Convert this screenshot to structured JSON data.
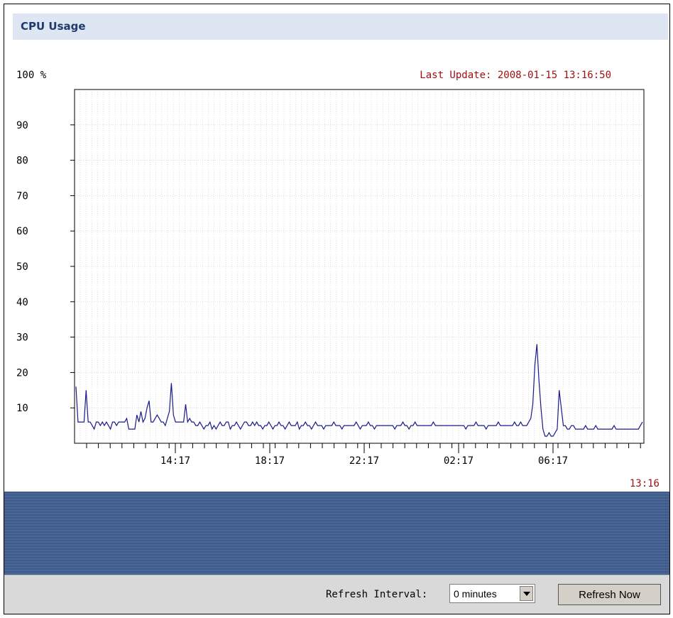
{
  "title": "CPU Usage",
  "chart": {
    "y_unit_label": "100 %",
    "last_update": "Last Update: 2008-01-15 13:16:50",
    "end_time_label": "13:16"
  },
  "chart_data": {
    "type": "line",
    "title": "CPU Usage",
    "ylim": [
      0,
      100
    ],
    "y_ticks": [
      "90",
      "80",
      "70",
      "60",
      "50",
      "40",
      "30",
      "20",
      "10"
    ],
    "x_tick_labels": [
      "14:17",
      "18:17",
      "22:17",
      "02:17",
      "06:17"
    ],
    "grid": true,
    "line_color": "#1a1a8c",
    "series": [
      {
        "values": [
          16,
          6,
          6,
          6,
          6,
          15,
          6,
          6,
          5,
          4,
          6,
          6,
          5,
          6,
          5,
          6,
          5,
          4,
          6,
          6,
          5,
          6,
          6,
          6,
          6,
          7,
          4,
          4,
          4,
          4,
          8,
          6,
          9,
          6,
          7,
          10,
          12,
          6,
          6,
          7,
          8,
          7,
          6,
          6,
          5,
          7,
          9,
          17,
          8,
          6,
          6,
          6,
          6,
          6,
          11,
          6,
          7,
          6,
          6,
          5,
          5,
          6,
          5,
          4,
          5,
          5,
          6,
          4,
          5,
          4,
          5,
          6,
          5,
          5,
          6,
          6,
          4,
          5,
          5,
          6,
          5,
          4,
          5,
          6,
          6,
          5,
          5,
          6,
          5,
          6,
          5,
          5,
          4,
          5,
          5,
          6,
          5,
          4,
          5,
          5,
          6,
          5,
          5,
          4,
          5,
          6,
          5,
          5,
          5,
          6,
          4,
          5,
          5,
          6,
          5,
          5,
          4,
          5,
          6,
          5,
          5,
          5,
          4,
          5,
          5,
          5,
          5,
          6,
          5,
          5,
          5,
          4,
          5,
          5,
          5,
          5,
          5,
          5,
          6,
          5,
          4,
          5,
          5,
          5,
          6,
          5,
          5,
          4,
          5,
          5,
          5,
          5,
          5,
          5,
          5,
          5,
          5,
          4,
          5,
          5,
          5,
          6,
          5,
          5,
          4,
          5,
          5,
          6,
          5,
          5,
          5,
          5,
          5,
          5,
          5,
          5,
          6,
          5,
          5,
          5,
          5,
          5,
          5,
          5,
          5,
          5,
          5,
          5,
          5,
          5,
          5,
          5,
          4,
          5,
          5,
          5,
          5,
          6,
          5,
          5,
          5,
          5,
          4,
          5,
          5,
          5,
          5,
          5,
          6,
          5,
          5,
          5,
          5,
          5,
          5,
          5,
          6,
          5,
          5,
          6,
          5,
          5,
          5,
          6,
          7,
          11,
          22,
          28,
          18,
          10,
          4,
          2,
          2,
          3,
          2,
          2,
          3,
          4,
          15,
          10,
          5,
          5,
          4,
          4,
          5,
          5,
          4,
          4,
          4,
          4,
          4,
          5,
          4,
          4,
          4,
          4,
          5,
          4,
          4,
          4,
          4,
          4,
          4,
          4,
          4,
          5,
          4,
          4,
          4,
          4,
          4,
          4,
          4,
          4,
          4,
          4,
          4,
          4,
          5,
          6
        ]
      }
    ]
  },
  "bottom_bar": {
    "refresh_label": "Refresh Interval:",
    "interval_value": "0 minutes",
    "refresh_button": "Refresh Now"
  }
}
